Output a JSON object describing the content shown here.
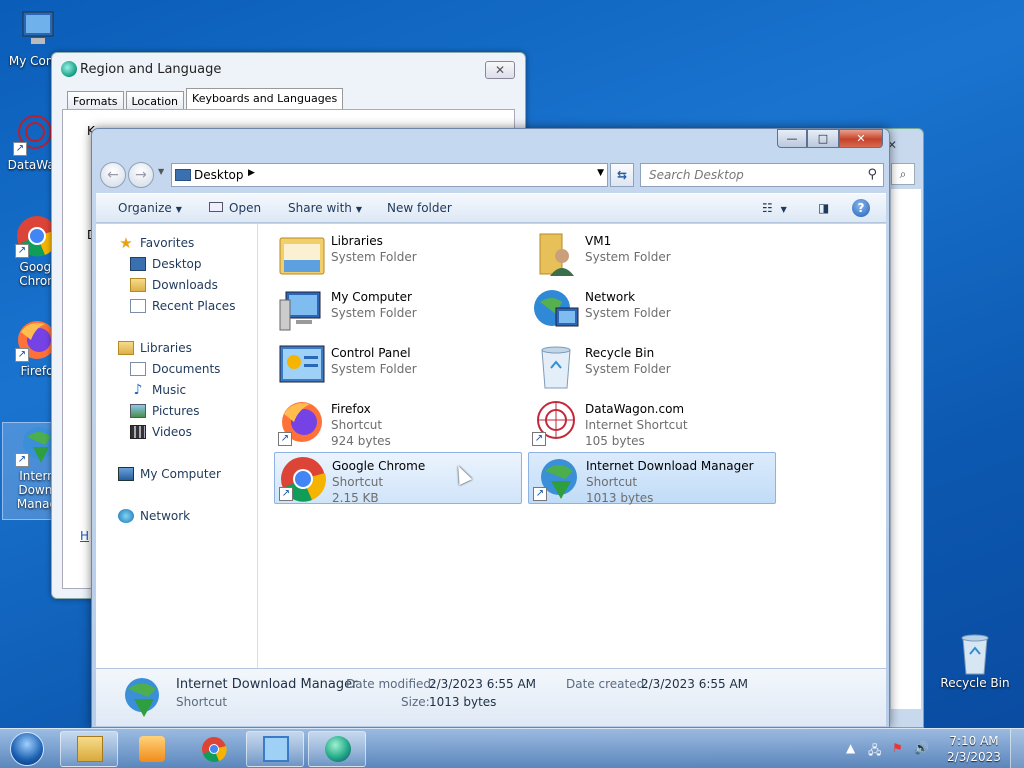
{
  "desktop": {
    "icons": [
      {
        "label": "My Comp",
        "icon": "computer-icon"
      },
      {
        "label": "DataWag",
        "icon": "datawagon-icon"
      },
      {
        "label": "Googl Chron",
        "icon": "chrome-icon"
      },
      {
        "label": "Firefo",
        "icon": "firefox-icon"
      },
      {
        "label": "Intern Downl Manag",
        "icon": "idm-icon"
      }
    ],
    "recycle_bin": "Recycle Bin"
  },
  "region_dialog": {
    "title": "Region and Language",
    "tabs": [
      "Formats",
      "Location",
      "Keyboards and Languages"
    ],
    "active_tab": "Keyboards and Languages",
    "fragments": [
      "K",
      "D",
      "H"
    ],
    "close": "✕"
  },
  "explorer": {
    "caption": {
      "minimize": "—",
      "maximize": "□",
      "close": "✕"
    },
    "address": "Desktop",
    "search_placeholder": "Search Desktop",
    "toolbar": {
      "organize": "Organize",
      "open": "Open",
      "share_with": "Share with",
      "new_folder": "New folder"
    },
    "nav": {
      "favorites": "Favorites",
      "desktop": "Desktop",
      "downloads": "Downloads",
      "recent_places": "Recent Places",
      "libraries": "Libraries",
      "documents": "Documents",
      "music": "Music",
      "pictures": "Pictures",
      "videos": "Videos",
      "my_computer": "My Computer",
      "network": "Network"
    },
    "items": [
      {
        "name": "Libraries",
        "type": "System Folder",
        "size": ""
      },
      {
        "name": "VM1",
        "type": "System Folder",
        "size": ""
      },
      {
        "name": "My Computer",
        "type": "System Folder",
        "size": ""
      },
      {
        "name": "Network",
        "type": "System Folder",
        "size": ""
      },
      {
        "name": "Control Panel",
        "type": "System Folder",
        "size": ""
      },
      {
        "name": "Recycle Bin",
        "type": "System Folder",
        "size": ""
      },
      {
        "name": "Firefox",
        "type": "Shortcut",
        "size": "924 bytes"
      },
      {
        "name": "DataWagon.com",
        "type": "Internet Shortcut",
        "size": "105 bytes"
      },
      {
        "name": "Google Chrome",
        "type": "Shortcut",
        "size": "2.15 KB"
      },
      {
        "name": "Internet Download Manager",
        "type": "Shortcut",
        "size": "1013 bytes"
      }
    ],
    "details": {
      "name": "Internet Download Manager",
      "type": "Shortcut",
      "date_modified_label": "Date modified:",
      "date_modified": "2/3/2023 6:55 AM",
      "date_created_label": "Date created:",
      "date_created": "2/3/2023 6:55 AM",
      "size_label": "Size:",
      "size": "1013 bytes"
    }
  },
  "taskbar": {
    "time": "7:10 AM",
    "date": "2/3/2023",
    "tray_arrow": "▲"
  }
}
